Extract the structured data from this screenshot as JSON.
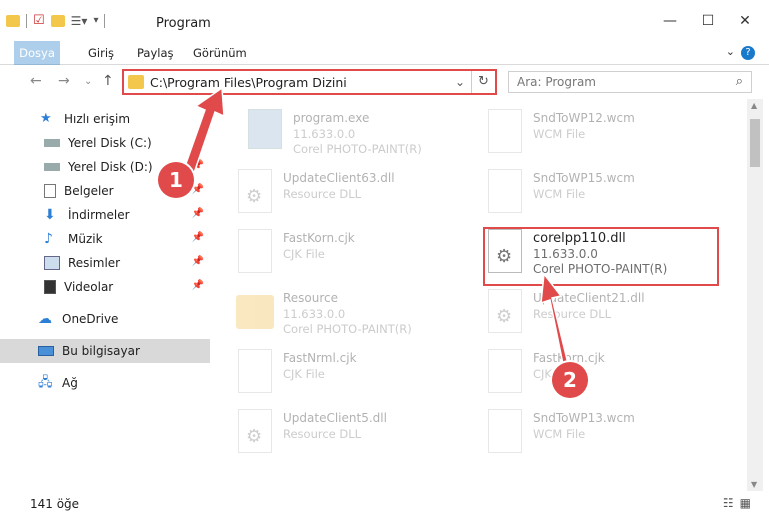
{
  "window": {
    "title": "Program"
  },
  "ribbon": {
    "tabs": [
      "Dosya",
      "Giriş",
      "Paylaş",
      "Görünüm"
    ]
  },
  "address": {
    "path": "C:\\Program Files\\Program Dizini"
  },
  "search": {
    "placeholder": "Ara: Program"
  },
  "sidebar": {
    "items": [
      {
        "label": "Hızlı erişim",
        "icon": "star-icon"
      },
      {
        "label": "Yerel Disk (C:)",
        "icon": "drive-icon"
      },
      {
        "label": "Yerel Disk (D:)",
        "icon": "drive-icon"
      },
      {
        "label": "Belgeler",
        "icon": "documents-icon"
      },
      {
        "label": "İndirmeler",
        "icon": "download-icon"
      },
      {
        "label": "Müzik",
        "icon": "music-icon"
      },
      {
        "label": "Resimler",
        "icon": "pictures-icon"
      },
      {
        "label": "Videolar",
        "icon": "videos-icon"
      },
      {
        "label": "OneDrive",
        "icon": "cloud-icon"
      },
      {
        "label": "Bu bilgisayar",
        "icon": "computer-icon"
      },
      {
        "label": "Ağ",
        "icon": "network-icon"
      }
    ]
  },
  "files": [
    {
      "name": "program.exe",
      "line2": "11.633.0.0",
      "line3": "Corel PHOTO-PAINT(R)"
    },
    {
      "name": "SndToWP12.wcm",
      "line2": "WCM File",
      "line3": ""
    },
    {
      "name": "UpdateClient63.dll",
      "line2": "Resource DLL",
      "line3": ""
    },
    {
      "name": "SndToWP15.wcm",
      "line2": "WCM File",
      "line3": ""
    },
    {
      "name": "FastKorn.cjk",
      "line2": "CJK File",
      "line3": ""
    },
    {
      "name": "corelpp110.dll",
      "line2": "11.633.0.0",
      "line3": "Corel PHOTO-PAINT(R)"
    },
    {
      "name": "Resource",
      "line2": "11.633.0.0",
      "line3": "Corel PHOTO-PAINT(R)"
    },
    {
      "name": "UpdateClient21.dll",
      "line2": "Resource DLL",
      "line3": ""
    },
    {
      "name": "FastNrml.cjk",
      "line2": "CJK File",
      "line3": ""
    },
    {
      "name": "FastKorn.cjk",
      "line2": "CJK File",
      "line3": ""
    },
    {
      "name": "UpdateClient5.dll",
      "line2": "Resource DLL",
      "line3": ""
    },
    {
      "name": "SndToWP13.wcm",
      "line2": "WCM File",
      "line3": ""
    }
  ],
  "status": {
    "count": "141 öğe"
  },
  "annotations": {
    "badge1": "1",
    "badge2": "2"
  },
  "colors": {
    "accent": "#1979ca",
    "highlight": "#e04a4a",
    "selected": "#d9d9d9"
  }
}
